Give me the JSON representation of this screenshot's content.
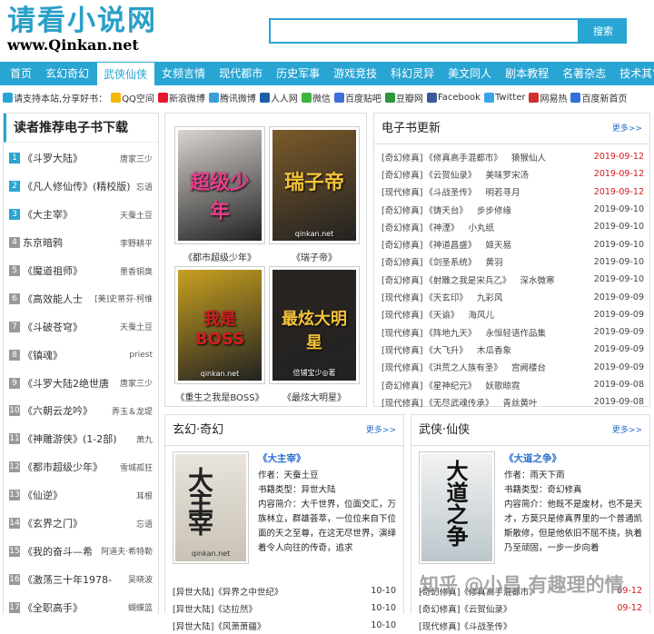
{
  "logo": {
    "cn": "请看小说网",
    "en": "www.Qinkan.net"
  },
  "search": {
    "placeholder": "",
    "button": "搜索"
  },
  "nav": [
    "首页",
    "玄幻奇幻",
    "武侠仙侠",
    "女频言情",
    "现代都市",
    "历史军事",
    "游戏竞技",
    "科幻灵异",
    "美文同人",
    "剧本教程",
    "名著杂志",
    "技术其它"
  ],
  "nav_active_index": 2,
  "share": {
    "prefix": "请支持本站,分享好书：",
    "items": [
      {
        "label": "QQ空间",
        "color": "#f4b800",
        "icon": "qzone-icon"
      },
      {
        "label": "新浪微博",
        "color": "#e6162d",
        "icon": "weibo-icon"
      },
      {
        "label": "腾讯微博",
        "color": "#3a9edb",
        "icon": "tencent-weibo-icon"
      },
      {
        "label": "人人网",
        "color": "#1c5ea8",
        "icon": "renren-icon"
      },
      {
        "label": "微信",
        "color": "#3eb53f",
        "icon": "wechat-icon"
      },
      {
        "label": "百度贴吧",
        "color": "#3f6fd8",
        "icon": "tieba-icon"
      },
      {
        "label": "豆瓣网",
        "color": "#2e963d",
        "icon": "douban-icon"
      },
      {
        "label": "Facebook",
        "color": "#3b5998",
        "icon": "facebook-icon"
      },
      {
        "label": "Twitter",
        "color": "#3aa5e8",
        "icon": "twitter-icon"
      },
      {
        "label": "网易热",
        "color": "#d03030",
        "icon": "netease-icon"
      },
      {
        "label": "百度新首页",
        "color": "#2f6fd8",
        "icon": "baidu-icon"
      }
    ]
  },
  "left": {
    "title": "读者推荐电子书下载",
    "items": [
      {
        "num": "1",
        "title": "《斗罗大陆》",
        "author": "唐家三少"
      },
      {
        "num": "2",
        "title": "《凡人修仙传》(精校版)",
        "author": "忘语"
      },
      {
        "num": "3",
        "title": "《大主宰》",
        "author": "天蚕土豆"
      },
      {
        "num": "4",
        "title": "东京暗鸦",
        "author": "李野耕平"
      },
      {
        "num": "5",
        "title": "《魔道祖师》",
        "author": "墨香铜臭"
      },
      {
        "num": "6",
        "title": "《高效能人士",
        "author": "[美]史蒂芬·柯维"
      },
      {
        "num": "7",
        "title": "《斗破苍穹》",
        "author": "天蚕土豆"
      },
      {
        "num": "8",
        "title": "《镇魂》",
        "author": "priest"
      },
      {
        "num": "9",
        "title": "《斗罗大陆2绝世唐",
        "author": "唐家三少"
      },
      {
        "num": "10",
        "title": "《六朝云龙吟》",
        "author": "弄玉＆龙堤"
      },
      {
        "num": "11",
        "title": "《神雕游侠》(1-2部)",
        "author": "萧九"
      },
      {
        "num": "12",
        "title": "《都市超级少年》",
        "author": "雪城孤狂"
      },
      {
        "num": "13",
        "title": "《仙逆》",
        "author": "耳根"
      },
      {
        "num": "14",
        "title": "《玄界之门》",
        "author": "忘语"
      },
      {
        "num": "15",
        "title": "《我的奋斗—希",
        "author": "阿道夫·希特勒"
      },
      {
        "num": "16",
        "title": "《激荡三十年1978-",
        "author": "吴晓波"
      },
      {
        "num": "17",
        "title": "《全职高手》",
        "author": "蝴蝶蓝"
      }
    ]
  },
  "rec": [
    {
      "caption": "《都市超级少年》",
      "cover_text": "超级少年",
      "bg": "#d9d4cf",
      "fg": "#e83e8c",
      "site": ""
    },
    {
      "caption": "《瑞子帝》",
      "cover_text": "瑞子帝",
      "bg": "#7a5a2a",
      "fg": "#f3c23a",
      "site": "qinkan.net"
    },
    {
      "caption": "《重生之我是BOSS》",
      "cover_text": "我是BOSS",
      "bg": "#c8a020",
      "fg": "#d02020",
      "site": "qinkan.net"
    },
    {
      "caption": "《最炫大明星》",
      "cover_text": "最炫大明星",
      "bg": "#2a2420",
      "fg": "#f3c23a",
      "site": "倍铺宝少◎著"
    }
  ],
  "updates": {
    "title": "电子书更新",
    "more": "更多>>",
    "items": [
      {
        "cat": "[奇幻修真]",
        "name": "《修真高手混都市》",
        "author": "猿猴仙人",
        "date": "2019-09-12",
        "red": true
      },
      {
        "cat": "[奇幻修真]",
        "name": "《云贺仙录》",
        "author": "美味罗宋汤",
        "date": "2019-09-12",
        "red": true
      },
      {
        "cat": "[现代修真]",
        "name": "《斗战圣传》",
        "author": "明若寻月",
        "date": "2019-09-12",
        "red": true
      },
      {
        "cat": "[奇幻修真]",
        "name": "《铸天台》",
        "author": "步步修缘",
        "date": "2019-09-10",
        "red": false
      },
      {
        "cat": "[奇幻修真]",
        "name": "《神湮》",
        "author": "小丸纸",
        "date": "2019-09-10",
        "red": false
      },
      {
        "cat": "[奇幻修真]",
        "name": "《神道昌盛》",
        "author": "姬天易",
        "date": "2019-09-10",
        "red": false
      },
      {
        "cat": "[奇幻修真]",
        "name": "《剑圣系统》",
        "author": "黄羽",
        "date": "2019-09-10",
        "red": false
      },
      {
        "cat": "[奇幻修真]",
        "name": "《射雕之我是宋兵乙》",
        "author": "深水微寒",
        "date": "2019-09-10",
        "red": false
      },
      {
        "cat": "[现代修真]",
        "name": "《天玄印》",
        "author": "九彩风",
        "date": "2019-09-09",
        "red": false
      },
      {
        "cat": "[现代修真]",
        "name": "《天谕》",
        "author": "海风儿",
        "date": "2019-09-09",
        "red": false
      },
      {
        "cat": "[现代修真]",
        "name": "《阵地九天》",
        "author": "永恒轻语作品集",
        "date": "2019-09-09",
        "red": false
      },
      {
        "cat": "[现代修真]",
        "name": "《大飞升》",
        "author": "木瓜香象",
        "date": "2019-09-09",
        "red": false
      },
      {
        "cat": "[现代修真]",
        "name": "《洪荒之人族有圣》",
        "author": "宫阙楼台",
        "date": "2019-09-09",
        "red": false
      },
      {
        "cat": "[奇幻修真]",
        "name": "《星神纪元》",
        "author": "妖歌晾霓",
        "date": "2019-09-08",
        "red": false
      },
      {
        "cat": "[现代修真]",
        "name": "《无尽武魂传承》",
        "author": "青丝黄叶",
        "date": "2019-09-08",
        "red": false
      }
    ]
  },
  "cat1": {
    "title": "玄幻·奇幻",
    "more": "更多>>",
    "book": {
      "title": "《大主宰》",
      "author": "作者：天蚕土豆",
      "type": "书籍类型：异世大陆",
      "desc": "内容简介：大千世界，位面交汇，万族林立，群雄荟萃，一位位来自下位面的天之至尊，在这无尽世界，演绎着令人向往的传奇，追求",
      "cover_text": "大主宰",
      "site": "qinkan.net"
    },
    "items": [
      {
        "cat": "[异世大陆]",
        "name": "《异界之中世纪》",
        "date": "10-10",
        "red": false
      },
      {
        "cat": "[异世大陆]",
        "name": "《达拉然》",
        "date": "10-10",
        "red": false
      },
      {
        "cat": "[异世大陆]",
        "name": "《风萧萧疆》",
        "date": "10-10",
        "red": false
      }
    ]
  },
  "cat2": {
    "title": "武侠·仙侠",
    "more": "更多>>",
    "book": {
      "title": "《大道之争》",
      "author": "作者：雨天下雨",
      "type": "书籍类型：奇幻修真",
      "desc": "内容简介：他既不是废材，也不是天才，方莫只是修真界里的一个普通凯斯散修，但是他依旧不屈不挠，执着乃至顽固，一步一步向着",
      "cover_text": "大道之争",
      "site": ""
    },
    "items": [
      {
        "cat": "[奇幻修真]",
        "name": "《修真高手混都市》",
        "date": "09-12",
        "red": true
      },
      {
        "cat": "[奇幻修真]",
        "name": "《云贺仙录》",
        "date": "09-12",
        "red": true
      },
      {
        "cat": "[现代修真]",
        "name": "《斗战圣传》",
        "date": "",
        "red": false
      }
    ]
  },
  "watermark": "知乎 @小昌 有趣理的情"
}
